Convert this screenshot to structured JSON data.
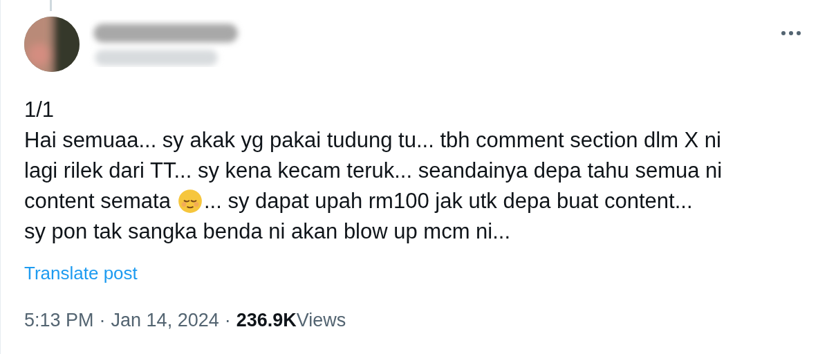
{
  "post": {
    "lines": [
      {
        "segments": [
          {
            "kind": "text",
            "text": "1/1"
          }
        ]
      },
      {
        "segments": [
          {
            "kind": "text",
            "text": "Hai semuaa... sy akak yg pakai tudung tu... tbh comment section dlm X ni"
          }
        ]
      },
      {
        "segments": [
          {
            "kind": "text",
            "text": "lagi rilek dari TT... sy kena kecam teruk... seandainya depa tahu semua ni"
          }
        ]
      },
      {
        "segments": [
          {
            "kind": "text",
            "text": "content semata"
          },
          {
            "kind": "emoji"
          },
          {
            "kind": "text",
            "text": "... sy dapat upah rm100 jak utk depa buat content..."
          }
        ]
      },
      {
        "segments": [
          {
            "kind": "text",
            "text": "sy pon tak sangka benda ni akan blow up mcm ni..."
          }
        ]
      }
    ],
    "translate_link": "Translate post",
    "time": "5:13 PM",
    "separators": [
      "·",
      "·"
    ],
    "date": "Jan 14, 2024",
    "views_count": "236.9K",
    "views_label": "Views"
  }
}
